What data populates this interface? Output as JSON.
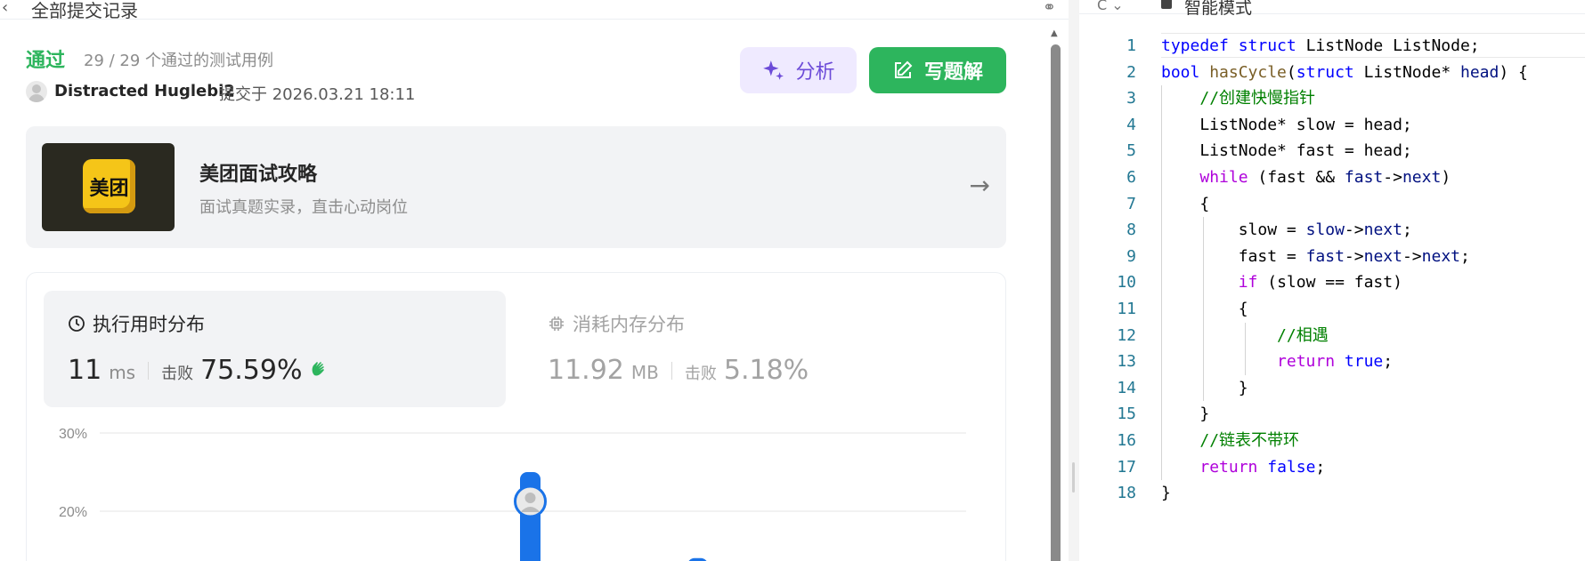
{
  "header": {
    "title": "全部提交记录"
  },
  "submission": {
    "status": "通过",
    "cases": "29 / 29 个通过的测试用例",
    "user": "Distracted Huglebi2",
    "submitted_at": "提交于 2026.03.21 18:11"
  },
  "actions": {
    "analyze_label": "分析",
    "solution_label": "写题解"
  },
  "ad": {
    "logo_text": "美团",
    "title": "美团面试攻略",
    "subtitle": "面试真题实录，直击心动岗位"
  },
  "runtime": {
    "heading": "执行用时分布",
    "value": "11",
    "unit": "ms",
    "beat_label": "击败",
    "beat_value": "75.59%"
  },
  "memory": {
    "heading": "消耗内存分布",
    "value": "11.92",
    "unit": "MB",
    "beat_label": "击败",
    "beat_value": "5.18%"
  },
  "chart_data": {
    "type": "bar",
    "title": "",
    "xlabel": "",
    "ylabel": "",
    "ylim": [
      0,
      30
    ],
    "ytick_labels": [
      "30%",
      "20%"
    ],
    "ytick_values": [
      30,
      20
    ],
    "bars": [
      {
        "label": "",
        "value": 25,
        "highlighted": true
      },
      {
        "label": "",
        "value": 14,
        "highlighted": false
      }
    ],
    "color": "#1a73e8"
  },
  "editor": {
    "mode_label": "智能模式",
    "lines": [
      {
        "n": "1",
        "t": "typedef struct ListNode ListNode;"
      },
      {
        "n": "2",
        "t": "bool hasCycle(struct ListNode* head) {"
      },
      {
        "n": "3",
        "t": "    //创建快慢指针"
      },
      {
        "n": "4",
        "t": "    ListNode* slow = head;"
      },
      {
        "n": "5",
        "t": "    ListNode* fast = head;"
      },
      {
        "n": "6",
        "t": "    while (fast && fast->next)"
      },
      {
        "n": "7",
        "t": "    {"
      },
      {
        "n": "8",
        "t": "        slow = slow->next;"
      },
      {
        "n": "9",
        "t": "        fast = fast->next->next;"
      },
      {
        "n": "10",
        "t": "        if (slow == fast)"
      },
      {
        "n": "11",
        "t": "        {"
      },
      {
        "n": "12",
        "t": "            //相遇"
      },
      {
        "n": "13",
        "t": "            return true;"
      },
      {
        "n": "14",
        "t": "        }"
      },
      {
        "n": "15",
        "t": "    }"
      },
      {
        "n": "16",
        "t": "    //链表不带环"
      },
      {
        "n": "17",
        "t": "    return false;"
      },
      {
        "n": "18",
        "t": "}"
      }
    ]
  }
}
